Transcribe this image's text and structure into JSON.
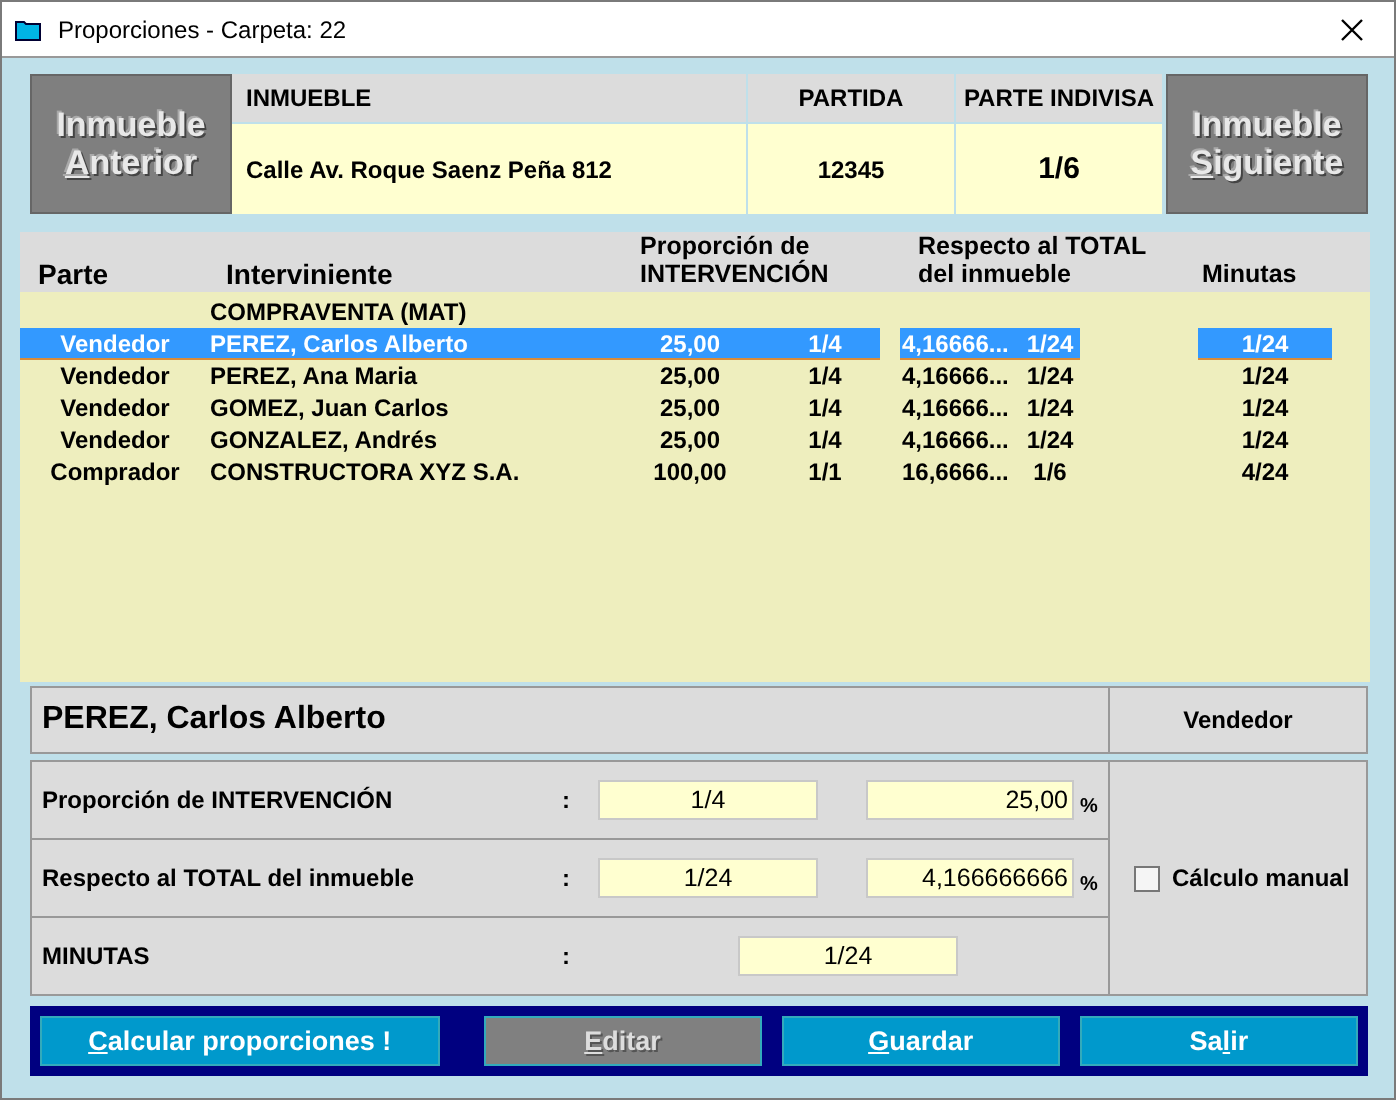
{
  "window": {
    "title": "Proporciones - Carpeta: 22"
  },
  "property": {
    "prev_button": {
      "line1": "Inmueble",
      "line2": {
        "key": "A",
        "post": "nterior"
      }
    },
    "columns": [
      "INMUEBLE",
      "PARTIDA",
      "PARTE INDIVISA"
    ],
    "values": [
      "Calle Av. Roque Saenz Peña 812",
      "12345",
      "1/6"
    ],
    "next_button": {
      "line1": "Inmueble",
      "line2": {
        "key": "S",
        "post": "iguiente"
      }
    }
  },
  "grid": {
    "columns": [
      "Parte",
      "Interviniente",
      "Proporción de INTERVENCIÓN",
      "Respecto al TOTAL del inmueble",
      "Minutas"
    ],
    "rows": [
      {
        "kind": "group",
        "label": "COMPRAVENTA (MAT)"
      },
      {
        "kind": "party",
        "selected": true,
        "cells": [
          "Vendedor",
          "PEREZ, Carlos Alberto",
          "25,00",
          "1/4",
          "4,16666...",
          "1/24",
          "1/24"
        ]
      },
      {
        "kind": "party",
        "selected": false,
        "cells": [
          "Vendedor",
          "PEREZ, Ana Maria",
          "25,00",
          "1/4",
          "4,16666...",
          "1/24",
          "1/24"
        ]
      },
      {
        "kind": "party",
        "selected": false,
        "cells": [
          "Vendedor",
          "GOMEZ, Juan Carlos",
          "25,00",
          "1/4",
          "4,16666...",
          "1/24",
          "1/24"
        ]
      },
      {
        "kind": "party",
        "selected": false,
        "cells": [
          "Vendedor",
          "GONZALEZ, Andrés",
          "25,00",
          "1/4",
          "4,16666...",
          "1/24",
          "1/24"
        ]
      },
      {
        "kind": "party",
        "selected": false,
        "cells": [
          "Comprador",
          "CONSTRUCTORA XYZ S.A.",
          "100,00",
          "1/1",
          "16,6666...",
          "1/6",
          "4/24"
        ]
      }
    ]
  },
  "detail": {
    "name": "PEREZ, Carlos Alberto",
    "role": "Vendedor",
    "fields": [
      {
        "kind": "pair",
        "label": "Proporción de INTERVENCIÓN",
        "colon": ":",
        "fraction": "1/4",
        "percent": "25,00",
        "unit": "%"
      },
      {
        "kind": "pair",
        "label": "Respecto al TOTAL del inmueble",
        "colon": ":",
        "fraction": "1/24",
        "percent": "4,166666666",
        "unit": "%"
      },
      {
        "kind": "single",
        "label": "MINUTAS",
        "colon": ":",
        "value": "1/24"
      }
    ],
    "manual": {
      "label": "Cálculo manual",
      "checked": false
    }
  },
  "buttons": [
    {
      "label": {
        "key": "C",
        "post": "alcular proporciones !"
      },
      "disabled": false
    },
    {
      "label": {
        "key": "E",
        "post": "ditar"
      },
      "disabled": true
    },
    {
      "label": {
        "key": "G",
        "post": "uardar"
      },
      "disabled": false
    },
    {
      "label": {
        "pre": "Sa",
        "key": "l",
        "post": "ir"
      },
      "disabled": false
    }
  ]
}
